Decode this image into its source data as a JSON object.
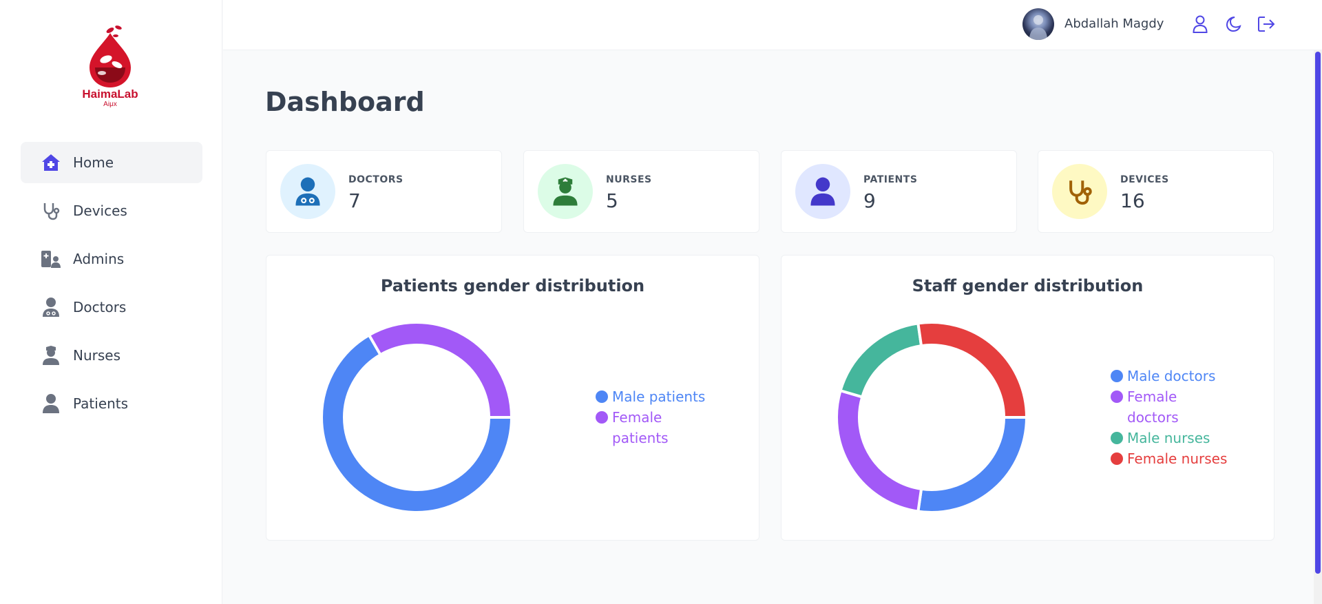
{
  "app": {
    "logo_name": "HaimaLab",
    "logo_subtitle": "Aiμx"
  },
  "sidebar": {
    "items": [
      {
        "label": "Home",
        "icon": "house-medical-icon",
        "active": true
      },
      {
        "label": "Devices",
        "icon": "stethoscope-icon",
        "active": false
      },
      {
        "label": "Admins",
        "icon": "hospital-user-icon",
        "active": false
      },
      {
        "label": "Doctors",
        "icon": "user-doctor-icon",
        "active": false
      },
      {
        "label": "Nurses",
        "icon": "user-nurse-icon",
        "active": false
      },
      {
        "label": "Patients",
        "icon": "user-icon",
        "active": false
      }
    ]
  },
  "header": {
    "username": "Abdallah Magdy",
    "icons": [
      "profile-icon",
      "moon-icon",
      "logout-icon"
    ]
  },
  "main": {
    "title": "Dashboard",
    "stats": [
      {
        "label": "DOCTORS",
        "value": "7",
        "icon": "user-doctor-icon",
        "bg": "#e0f2fe",
        "color": "#1d6fb8"
      },
      {
        "label": "NURSES",
        "value": "5",
        "icon": "user-nurse-icon",
        "bg": "#dcfce7",
        "color": "#2e7d3a"
      },
      {
        "label": "PATIENTS",
        "value": "9",
        "icon": "user-icon",
        "bg": "#e0e7ff",
        "color": "#4338ca"
      },
      {
        "label": "DEVICES",
        "value": "16",
        "icon": "stethoscope-icon",
        "bg": "#fef9c3",
        "color": "#a16207"
      }
    ]
  },
  "chart_data": [
    {
      "type": "pie",
      "title": "Patients gender distribution",
      "categories": [
        "Male patients",
        "Female patients"
      ],
      "values": [
        6,
        3
      ],
      "colors": [
        "#4e86f5",
        "#a259f7"
      ],
      "legend": "right"
    },
    {
      "type": "pie",
      "title": "Staff gender distribution",
      "categories": [
        "Male doctors",
        "Female doctors",
        "Male nurses",
        "Female nurses"
      ],
      "values": [
        3,
        3,
        2,
        3
      ],
      "colors": [
        "#4e86f5",
        "#a259f7",
        "#45b69c",
        "#e53e3e"
      ],
      "legend": "right"
    }
  ],
  "colors": {
    "accent": "#4f46e5",
    "text": "#374151"
  }
}
